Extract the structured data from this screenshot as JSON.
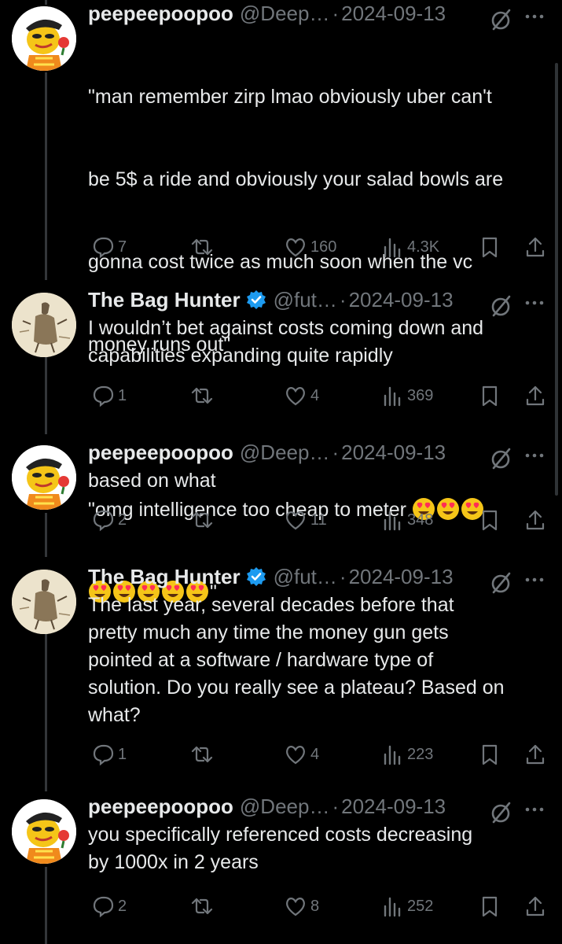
{
  "tweets": [
    {
      "name": "peepeepoopoo",
      "handle": "@Deep…",
      "date": "2024-09-13",
      "verified": false,
      "text_lines": [
        "\"man remember zirp lmao obviously uber can't",
        "be 5$ a ride and obviously your salad bowls are",
        "gonna cost twice as much soon when the vc",
        "money runs out\"",
        "",
        "\"omg intelligence too cheap to meter "
      ],
      "text_line7_suffix": "\"",
      "emoji": "heart-eyes-emoji",
      "replies": "7",
      "reposts": "",
      "likes": "160",
      "views": "4.3K"
    },
    {
      "name": "The Bag Hunter",
      "handle": "@fut…",
      "date": "2024-09-13",
      "verified": true,
      "text": "I wouldn’t bet against costs coming down and\ncapabilities expanding quite rapidly",
      "replies": "1",
      "reposts": "",
      "likes": "4",
      "views": "369"
    },
    {
      "name": "peepeepoopoo",
      "handle": "@Deep…",
      "date": "2024-09-13",
      "verified": false,
      "text": "based on what",
      "replies": "2",
      "reposts": "",
      "likes": "11",
      "views": "348"
    },
    {
      "name": "The Bag Hunter",
      "handle": "@fut…",
      "date": "2024-09-13",
      "verified": true,
      "text": "The last year, several decades before that\npretty much any time the money gun gets\npointed at a software / hardware type of\nsolution. Do you really see a plateau? Based on\nwhat?",
      "replies": "1",
      "reposts": "",
      "likes": "4",
      "views": "223"
    },
    {
      "name": "peepeepoopoo",
      "handle": "@Deep…",
      "date": "2024-09-13",
      "verified": false,
      "text": "you specifically referenced costs decreasing\nby 1000x in 2 years",
      "replies": "2",
      "reposts": "",
      "likes": "8",
      "views": "252"
    }
  ],
  "separator": "·",
  "icons": [
    "reply-icon",
    "repost-icon",
    "like-icon",
    "views-icon",
    "bookmark-icon",
    "share-icon",
    "grok-icon",
    "more-icon",
    "verified-badge-icon"
  ],
  "colors": {
    "background": "#000000",
    "text": "#e7e9ea",
    "muted": "#71767b",
    "verified": "#1d9bf0",
    "emoji": "#f5c518",
    "heart": "#ff2d55"
  }
}
